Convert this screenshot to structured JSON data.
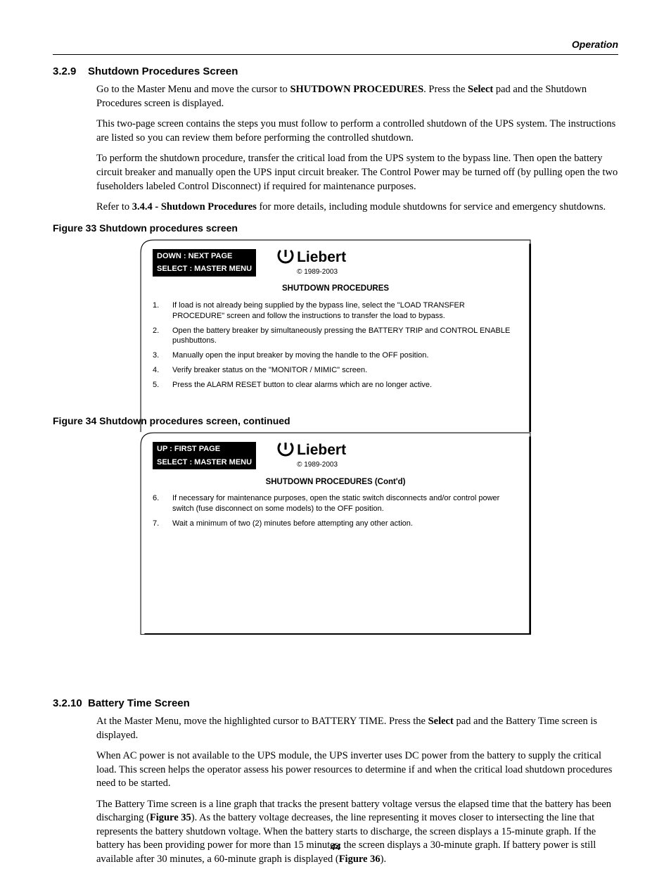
{
  "running_head": "Operation",
  "section1": {
    "num": "3.2.9",
    "title": "Shutdown Procedures Screen",
    "p1a": "Go to the Master Menu and move the cursor to ",
    "p1b": "SHUTDOWN PROCEDURES",
    "p1c": ". Press the ",
    "p1d": "Select",
    "p1e": " pad and the Shutdown Procedures screen is displayed.",
    "p2": "This two-page screen contains the steps you must follow to perform a controlled shutdown of the UPS system. The instructions are listed so you can review them before performing the controlled shutdown.",
    "p3": "To perform the shutdown procedure, transfer the critical load from the UPS system to the bypass line. Then open the battery circuit breaker and manually open the UPS input circuit breaker. The Control Power may be turned off (by pulling open the two fuseholders labeled Control Disconnect) if required for maintenance purposes.",
    "p4a": "Refer to ",
    "p4b": "3.4.4 - Shutdown Procedures",
    "p4c": " for more details, including module shutdowns for service and emergency shutdowns."
  },
  "fig33": {
    "caption": "Figure 33  Shutdown procedures screen",
    "nav_top": "DOWN  :  NEXT PAGE",
    "nav_bottom": "SELECT  :  MASTER MENU",
    "brand": "Liebert",
    "copyright": "© 1989-2003",
    "title": "SHUTDOWN PROCEDURES",
    "steps": [
      {
        "n": "1.",
        "t": "If load is not already being supplied by the bypass line, select the \"LOAD TRANSFER PROCEDURE\" screen and follow the instructions to transfer the load to bypass."
      },
      {
        "n": "2.",
        "t": "Open the battery breaker by simultaneously pressing the BATTERY TRIP and CONTROL ENABLE pushbuttons."
      },
      {
        "n": "3.",
        "t": "Manually open the input breaker by moving the handle to the OFF position."
      },
      {
        "n": "4.",
        "t": "Verify breaker status on the \"MONITOR / MIMIC\" screen."
      },
      {
        "n": "5.",
        "t": "Press the ALARM RESET button to clear alarms which are no longer active."
      }
    ]
  },
  "fig34": {
    "caption": "Figure 34  Shutdown procedures screen, continued",
    "nav_top": "UP  :  FIRST PAGE",
    "nav_bottom": "SELECT  :  MASTER MENU",
    "brand": "Liebert",
    "copyright": "© 1989-2003",
    "title": "SHUTDOWN PROCEDURES (Cont'd)",
    "steps": [
      {
        "n": "6.",
        "t": "If necessary for maintenance purposes, open the static switch disconnects and/or control power switch (fuse disconnect on some models) to the OFF position."
      },
      {
        "n": "7.",
        "t": "Wait a minimum of two (2) minutes before attempting any other action."
      }
    ]
  },
  "section2": {
    "num": "3.2.10",
    "title": "Battery Time Screen",
    "p1a": "At the Master Menu, move the highlighted cursor to BATTERY TIME. Press the ",
    "p1b": "Select",
    "p1c": " pad and the Battery Time screen is displayed.",
    "p2": "When AC power is not available to the UPS module, the UPS inverter uses DC power from the battery to supply the critical load. This screen helps the operator assess his power resources to determine if and when the critical load shutdown procedures need to be started.",
    "p3a": "The Battery Time screen is a line graph that tracks the present battery voltage versus the elapsed time that the battery has been discharging (",
    "p3b": "Figure 35",
    "p3c": "). As the battery voltage decreases, the line representing it moves closer to intersecting the line that represents the battery shutdown voltage. When the battery starts to discharge, the screen displays a 15-minute graph. If the battery has been providing power for more than 15 minutes, the screen displays a 30-minute graph. If battery power is still available after 30 minutes, a 60-minute graph is displayed (",
    "p3d": "Figure 36",
    "p3e": ")."
  },
  "page_number": "44"
}
